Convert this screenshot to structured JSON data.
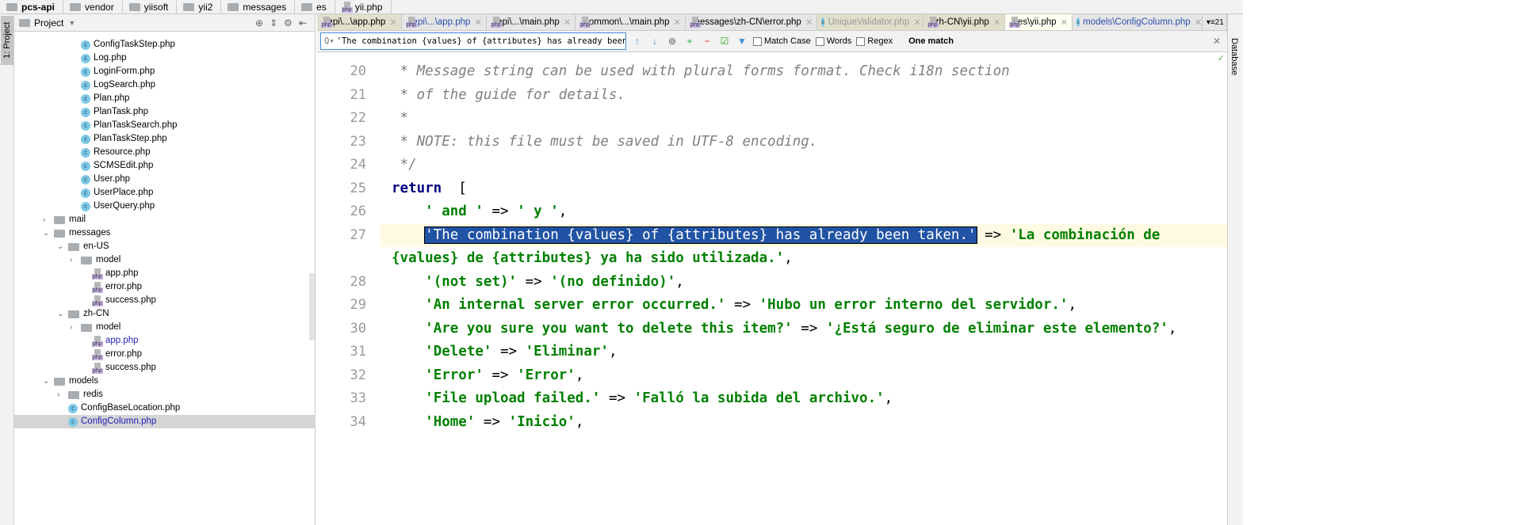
{
  "breadcrumb": [
    "pcs-api",
    "vendor",
    "yiisoft",
    "yii2",
    "messages",
    "es",
    "yii.php"
  ],
  "left_tool": "1: Project",
  "right_tool": "Database",
  "project": {
    "title": "Project",
    "rows": [
      {
        "label": "ConfigTaskStep.php",
        "icon": "class",
        "level": 4
      },
      {
        "label": "Log.php",
        "icon": "class",
        "level": 4
      },
      {
        "label": "LoginForm.php",
        "icon": "class",
        "level": 4
      },
      {
        "label": "LogSearch.php",
        "icon": "class",
        "level": 4
      },
      {
        "label": "Plan.php",
        "icon": "class",
        "level": 4
      },
      {
        "label": "PlanTask.php",
        "icon": "class",
        "level": 4
      },
      {
        "label": "PlanTaskSearch.php",
        "icon": "class",
        "level": 4
      },
      {
        "label": "PlanTaskStep.php",
        "icon": "class",
        "level": 4
      },
      {
        "label": "Resource.php",
        "icon": "class",
        "level": 4
      },
      {
        "label": "SCMSEdit.php",
        "icon": "class",
        "level": 4
      },
      {
        "label": "User.php",
        "icon": "class",
        "level": 4
      },
      {
        "label": "UserPlace.php",
        "icon": "class",
        "level": 4
      },
      {
        "label": "UserQuery.php",
        "icon": "class",
        "level": 4
      },
      {
        "label": "mail",
        "icon": "folder",
        "level": 2,
        "arrow": "closed"
      },
      {
        "label": "messages",
        "icon": "folder",
        "level": 2,
        "arrow": "open"
      },
      {
        "label": "en-US",
        "icon": "folder",
        "level": 3,
        "arrow": "open"
      },
      {
        "label": "model",
        "icon": "folder",
        "level": 4,
        "arrow": "closed"
      },
      {
        "label": "app.php",
        "icon": "php",
        "level": 5
      },
      {
        "label": "error.php",
        "icon": "php",
        "level": 5
      },
      {
        "label": "success.php",
        "icon": "php",
        "level": 5
      },
      {
        "label": "zh-CN",
        "icon": "folder",
        "level": 3,
        "arrow": "open"
      },
      {
        "label": "model",
        "icon": "folder",
        "level": 4,
        "arrow": "closed"
      },
      {
        "label": "app.php",
        "icon": "php",
        "level": 5,
        "blue": true
      },
      {
        "label": "error.php",
        "icon": "php",
        "level": 5
      },
      {
        "label": "success.php",
        "icon": "php",
        "level": 5
      },
      {
        "label": "models",
        "icon": "folder",
        "level": 2,
        "arrow": "open"
      },
      {
        "label": "redis",
        "icon": "folder",
        "level": 3,
        "arrow": "closed"
      },
      {
        "label": "ConfigBaseLocation.php",
        "icon": "class",
        "level": 3
      },
      {
        "label": "ConfigColumn.php",
        "icon": "class",
        "level": 3,
        "selected": true,
        "blue": true
      }
    ]
  },
  "tabs": [
    {
      "label": "api\\...\\app.php",
      "icon": "php",
      "style": "beige"
    },
    {
      "label": "api\\...\\app.php",
      "icon": "php",
      "style": "blue"
    },
    {
      "label": "api\\...\\main.php",
      "icon": "php",
      "style": ""
    },
    {
      "label": "common\\...\\main.php",
      "icon": "php",
      "style": ""
    },
    {
      "label": "messages\\zh-CN\\error.php",
      "icon": "php",
      "style": ""
    },
    {
      "label": "UniqueValidator.php",
      "icon": "class",
      "style": "beige grey"
    },
    {
      "label": "zh-CN\\yii.php",
      "icon": "php",
      "style": "beige"
    },
    {
      "label": "es\\yii.php",
      "icon": "php",
      "style": "active"
    },
    {
      "label": "models\\ConfigColumn.php",
      "icon": "class",
      "style": "blue"
    }
  ],
  "tabs_overflow": "21",
  "search": {
    "value": "'The combination {values} of {attributes} has already been taken.'",
    "match_case": "Match Case",
    "words": "Words",
    "regex": "Regex",
    "result": "One match"
  },
  "code": [
    {
      "n": "20",
      "seg": [
        [
          "com",
          " * Message string can be used with plural forms format. Check i18n section"
        ]
      ]
    },
    {
      "n": "21",
      "seg": [
        [
          "com",
          " * of the guide for details."
        ]
      ]
    },
    {
      "n": "22",
      "seg": [
        [
          "com",
          " *"
        ]
      ]
    },
    {
      "n": "23",
      "seg": [
        [
          "com",
          " * NOTE: this file must be saved in UTF-8 encoding."
        ]
      ]
    },
    {
      "n": "24",
      "seg": [
        [
          "com",
          " */"
        ]
      ]
    },
    {
      "n": "25",
      "seg": [
        [
          "kw",
          "return"
        ],
        [
          "",
          "  ["
        ]
      ]
    },
    {
      "n": "26",
      "seg": [
        [
          "",
          "    "
        ],
        [
          "str",
          "' and '"
        ],
        [
          "",
          " => "
        ],
        [
          "str",
          "' y '"
        ],
        [
          "",
          ","
        ]
      ]
    },
    {
      "n": "27",
      "cur": true,
      "seg": [
        [
          "",
          "    "
        ],
        [
          "hl",
          "'The combination {values} of {attributes} has already been taken.'"
        ],
        [
          "",
          " => "
        ],
        [
          "str",
          "'La combinación de"
        ]
      ]
    },
    {
      "n": "",
      "seg": [
        [
          "str",
          "{values} de {attributes} ya ha sido utilizada.'"
        ],
        [
          "",
          ","
        ]
      ]
    },
    {
      "n": "28",
      "seg": [
        [
          "",
          "    "
        ],
        [
          "str",
          "'(not set)'"
        ],
        [
          "",
          " => "
        ],
        [
          "str",
          "'(no definido)'"
        ],
        [
          "",
          ","
        ]
      ]
    },
    {
      "n": "29",
      "seg": [
        [
          "",
          "    "
        ],
        [
          "str",
          "'An internal server error occurred.'"
        ],
        [
          "",
          " => "
        ],
        [
          "str",
          "'Hubo un error interno del servidor.'"
        ],
        [
          "",
          ","
        ]
      ]
    },
    {
      "n": "30",
      "seg": [
        [
          "",
          "    "
        ],
        [
          "str",
          "'Are you sure you want to delete this item?'"
        ],
        [
          "",
          " => "
        ],
        [
          "str",
          "'¿Está seguro de eliminar este elemento?'"
        ],
        [
          "",
          ","
        ]
      ]
    },
    {
      "n": "31",
      "seg": [
        [
          "",
          "    "
        ],
        [
          "str",
          "'Delete'"
        ],
        [
          "",
          " => "
        ],
        [
          "str",
          "'Eliminar'"
        ],
        [
          "",
          ","
        ]
      ]
    },
    {
      "n": "32",
      "seg": [
        [
          "",
          "    "
        ],
        [
          "str",
          "'Error'"
        ],
        [
          "",
          " => "
        ],
        [
          "str",
          "'Error'"
        ],
        [
          "",
          ","
        ]
      ]
    },
    {
      "n": "33",
      "seg": [
        [
          "",
          "    "
        ],
        [
          "str",
          "'File upload failed.'"
        ],
        [
          "",
          " => "
        ],
        [
          "str",
          "'Falló la subida del archivo.'"
        ],
        [
          "",
          ","
        ]
      ]
    },
    {
      "n": "34",
      "seg": [
        [
          "",
          "    "
        ],
        [
          "str",
          "'Home'"
        ],
        [
          "",
          " => "
        ],
        [
          "str",
          "'Inicio'"
        ],
        [
          "",
          ","
        ]
      ]
    }
  ]
}
